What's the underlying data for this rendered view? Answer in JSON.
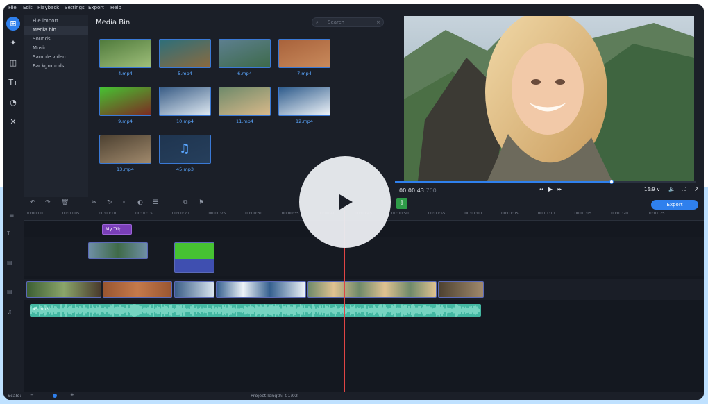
{
  "menu": [
    "File",
    "Edit",
    "Playback",
    "Settings",
    "Export",
    "Help"
  ],
  "tools": [
    {
      "icon": "import-icon",
      "glyph": "⊞"
    },
    {
      "icon": "magic-wand-icon",
      "glyph": "✦"
    },
    {
      "icon": "filters-icon",
      "glyph": "◫"
    },
    {
      "icon": "titles-icon",
      "glyph": "Tт"
    },
    {
      "icon": "stickers-icon",
      "glyph": "◔"
    },
    {
      "icon": "more-tools-icon",
      "glyph": "✕"
    }
  ],
  "subnav": [
    "File import",
    "Media bin",
    "Sounds",
    "Music",
    "Sample video",
    "Backgrounds"
  ],
  "bin": {
    "title": "Media Bin",
    "search_placeholder": "Search",
    "items": [
      {
        "label": "4.mp4",
        "c1": "#4f7a3c",
        "c2": "#9fbf7a"
      },
      {
        "label": "5.mp4",
        "c1": "#2d6f7a",
        "c2": "#8b6a3f"
      },
      {
        "label": "6.mp4",
        "c1": "#5d7f8f",
        "c2": "#3d6a4a"
      },
      {
        "label": "7.mp4",
        "c1": "#a8623b",
        "c2": "#c98a5c"
      },
      {
        "label": "9.mp4",
        "c1": "#46c232",
        "c2": "#7d2a22"
      },
      {
        "label": "10.mp4",
        "c1": "#3a5d86",
        "c2": "#dfe9f2"
      },
      {
        "label": "11.mp4",
        "c1": "#6f8a6a",
        "c2": "#d9b98a"
      },
      {
        "label": "12.mp4",
        "c1": "#2f5c8c",
        "c2": "#eef3f8"
      },
      {
        "label": "13.mp4",
        "c1": "#4d4131",
        "c2": "#a0896c"
      },
      {
        "label": "45.mp3",
        "c1": "#1f3550",
        "c2": "#263f5c"
      }
    ]
  },
  "preview": {
    "time_current": "00:00:43",
    "time_frames": ".700",
    "aspect": "16:9 ∨",
    "progress": 0.72
  },
  "timeline": {
    "export_label": "Export",
    "ruler": [
      "00:00:00",
      "00:00:05",
      "00:00:10",
      "00:00:15",
      "00:00:20",
      "00:00:25",
      "00:00:30",
      "00:00:35",
      "00:00:40",
      "00:00:45",
      "00:00:50",
      "00:00:55",
      "00:01:00",
      "00:01:05",
      "00:01:10",
      "00:01:15",
      "00:01:20",
      "00:01:25"
    ],
    "title_clip": "My Trip",
    "audio_label": "45.mp3",
    "scale_label": "Scale:",
    "project_length": "Project length: 01:02"
  }
}
